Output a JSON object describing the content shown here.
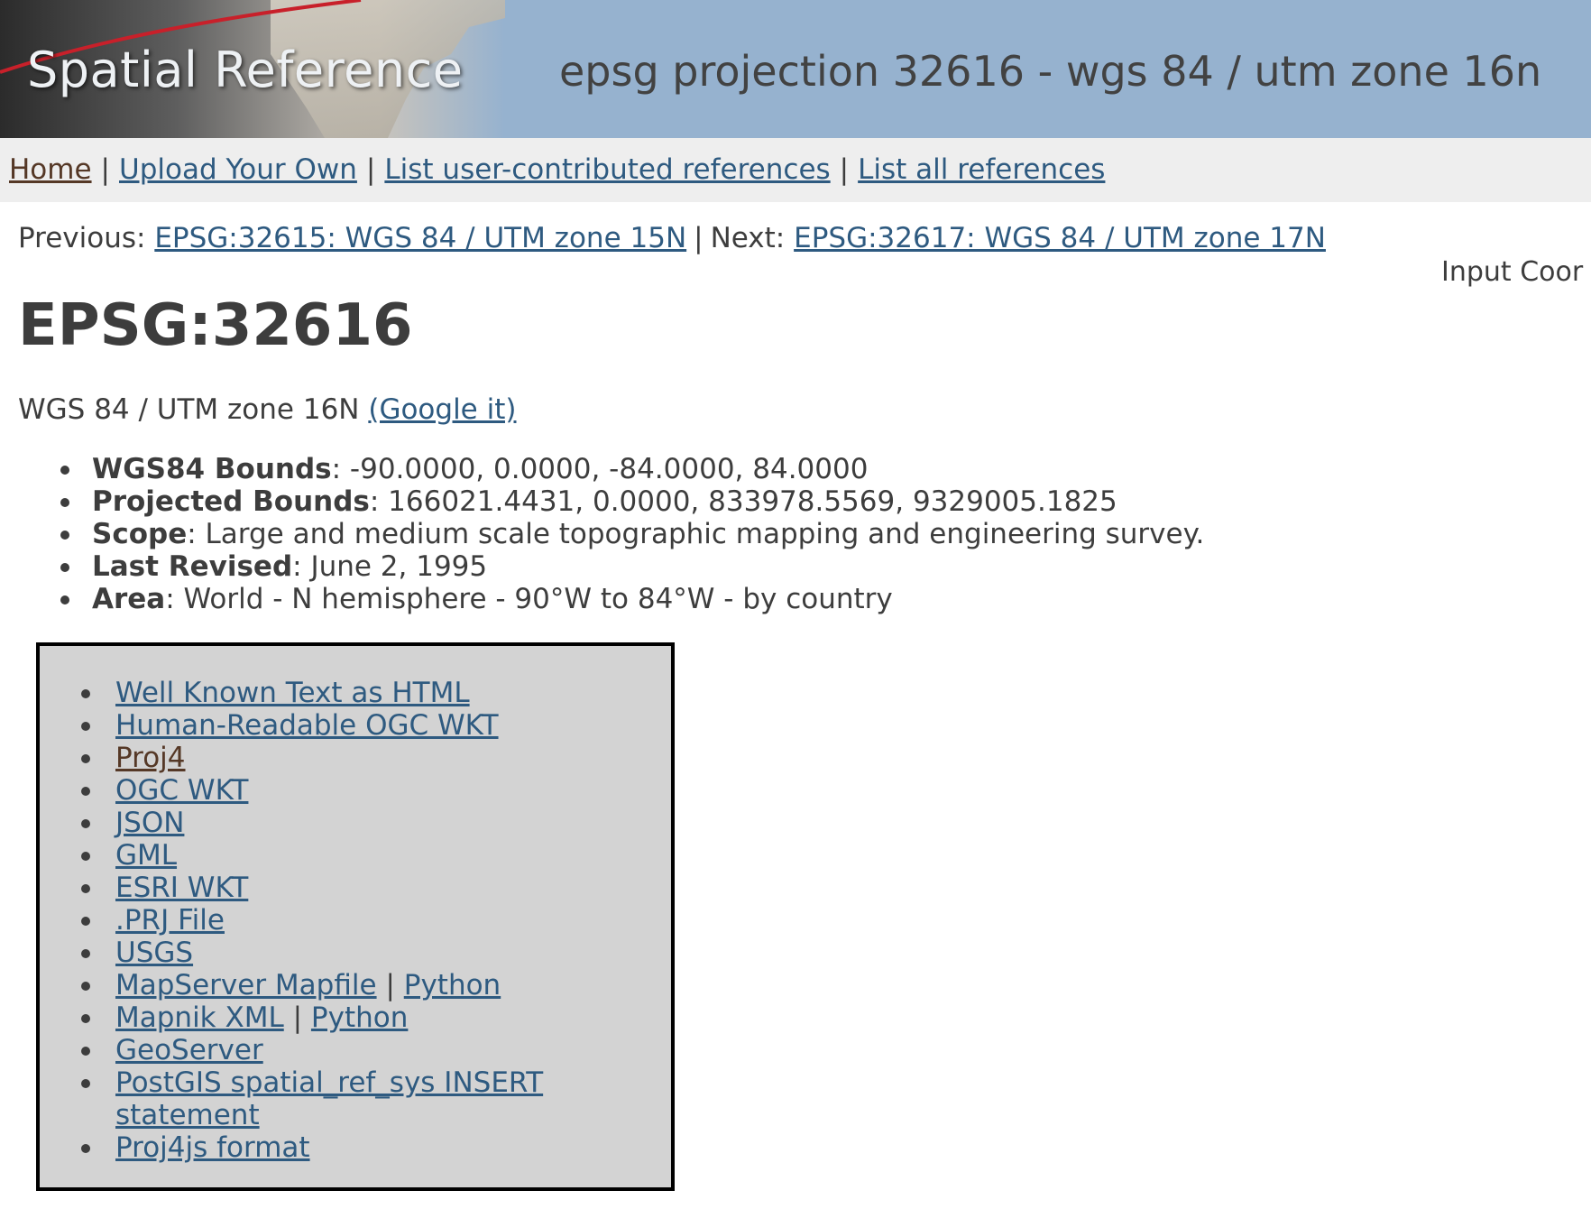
{
  "header": {
    "logo_text": "Spatial Reference",
    "title": "epsg projection 32616 - wgs 84 / utm zone 16n"
  },
  "nav": {
    "items": [
      {
        "label": "Home"
      },
      {
        "label": "Upload Your Own"
      },
      {
        "label": "List user-contributed references"
      },
      {
        "label": "List all references"
      }
    ],
    "separator": "|"
  },
  "prevnext": {
    "previous_label": "Previous:",
    "previous_link": "EPSG:32615: WGS 84 / UTM zone 15N",
    "separator": "|",
    "next_label": "Next:",
    "next_link": "EPSG:32617: WGS 84 / UTM zone 17N"
  },
  "input_coord_label": "Input Coor",
  "page_title": "EPSG:32616",
  "subtitle": {
    "text": "WGS 84 / UTM zone 16N",
    "google_link": "(Google it)"
  },
  "info": [
    {
      "key": "WGS84 Bounds",
      "value": ": -90.0000, 0.0000, -84.0000, 84.0000"
    },
    {
      "key": "Projected Bounds",
      "value": ": 166021.4431, 0.0000, 833978.5569, 9329005.1825"
    },
    {
      "key": "Scope",
      "value": ": Large and medium scale topographic mapping and engineering survey."
    },
    {
      "key": "Last Revised",
      "value": ": June 2, 1995"
    },
    {
      "key": "Area",
      "value": ": World - N hemisphere - 90°W to 84°W - by country"
    }
  ],
  "formats": {
    "well_known_text_html": "Well Known Text as HTML",
    "human_readable_ogc_wkt": "Human-Readable OGC WKT",
    "proj4": "Proj4",
    "ogc_wkt": "OGC WKT",
    "json": "JSON",
    "gml": "GML",
    "esri_wkt": "ESRI WKT",
    "prj_file": ".PRJ File",
    "usgs": "USGS",
    "mapserver_mapfile": "MapServer Mapfile",
    "mapserver_python": "Python",
    "mapnik_xml": "Mapnik XML",
    "mapnik_python": "Python",
    "geoserver": "GeoServer",
    "postgis_insert": "PostGIS spatial_ref_sys INSERT statement",
    "proj4js_format": "Proj4js format",
    "pipe": "|"
  },
  "colors": {
    "header_bg": "#96b2cf",
    "nav_bg": "#eeeeee",
    "link": "#2e5a80",
    "visited_link": "#553826",
    "box_bg": "#d3d3d3"
  }
}
